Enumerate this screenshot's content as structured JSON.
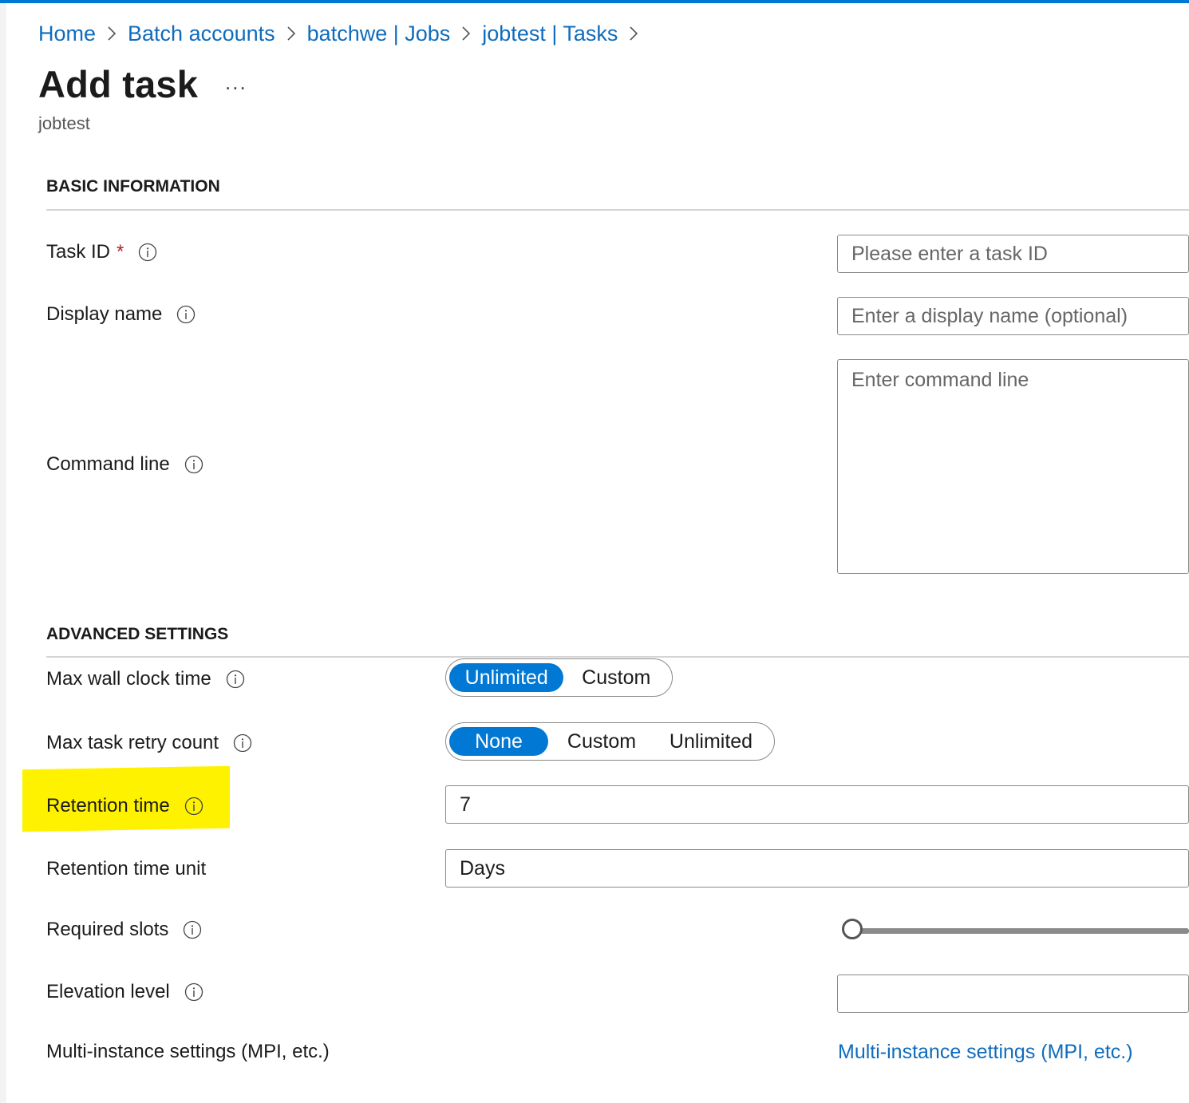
{
  "breadcrumb": {
    "items": [
      "Home",
      "Batch accounts",
      "batchwe | Jobs",
      "jobtest | Tasks"
    ]
  },
  "page": {
    "title": "Add task",
    "more_label": "...",
    "subtitle": "jobtest"
  },
  "basic": {
    "header": "BASIC INFORMATION",
    "task_id": {
      "label": "Task ID",
      "required_mark": "*",
      "placeholder": "Please enter a task ID"
    },
    "display_name": {
      "label": "Display name",
      "placeholder": "Enter a display name (optional)"
    },
    "command_line": {
      "label": "Command line",
      "placeholder": "Enter command line"
    }
  },
  "advanced": {
    "header": "ADVANCED SETTINGS",
    "max_wall_clock": {
      "label": "Max wall clock time",
      "options": [
        "Unlimited",
        "Custom"
      ],
      "selected": "Unlimited"
    },
    "max_retry": {
      "label": "Max task retry count",
      "options": [
        "None",
        "Custom",
        "Unlimited"
      ],
      "selected": "None"
    },
    "retention_time": {
      "label": "Retention time",
      "value": "7",
      "highlighted": true
    },
    "retention_unit": {
      "label": "Retention time unit",
      "value": "Days"
    },
    "required_slots": {
      "label": "Required slots",
      "slider_fraction": 0
    },
    "elevation_level": {
      "label": "Elevation level",
      "value": ""
    },
    "multi_instance": {
      "label": "Multi-instance settings (MPI, etc.)",
      "link": "Multi-instance settings (MPI, etc.)"
    }
  },
  "colors": {
    "accent": "#0078d4",
    "link": "#0f6cbd",
    "highlight": "#fff200",
    "required": "#a4262c"
  },
  "icons": {
    "breadcrumb_separator": "chevron-right-icon",
    "info": "info-icon"
  }
}
